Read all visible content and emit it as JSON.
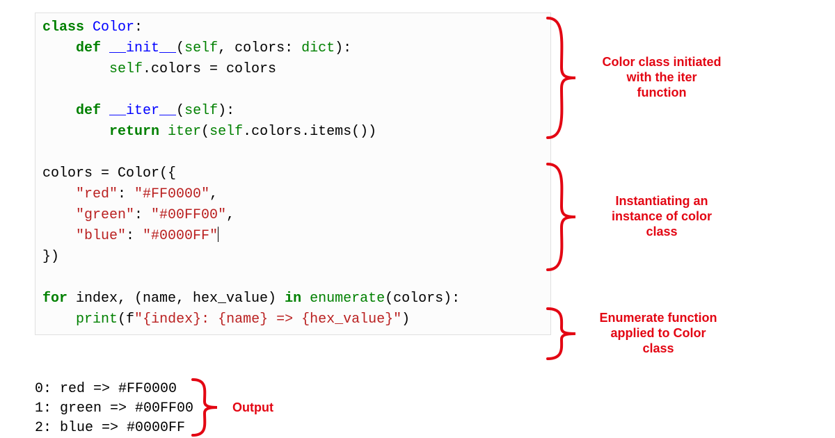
{
  "code": {
    "lines": [
      [
        {
          "t": "class ",
          "c": "kw"
        },
        {
          "t": "Color",
          "c": "cls"
        },
        {
          "t": ":",
          "c": ""
        }
      ],
      [
        {
          "t": "    ",
          "c": ""
        },
        {
          "t": "def ",
          "c": "kw"
        },
        {
          "t": "__init__",
          "c": "dunder"
        },
        {
          "t": "(",
          "c": ""
        },
        {
          "t": "self",
          "c": "builtin"
        },
        {
          "t": ", colors: ",
          "c": ""
        },
        {
          "t": "dict",
          "c": "builtin"
        },
        {
          "t": "):",
          "c": ""
        }
      ],
      [
        {
          "t": "        ",
          "c": ""
        },
        {
          "t": "self",
          "c": "builtin"
        },
        {
          "t": ".colors = colors",
          "c": ""
        }
      ],
      [
        {
          "t": "",
          "c": ""
        }
      ],
      [
        {
          "t": "    ",
          "c": ""
        },
        {
          "t": "def ",
          "c": "kw"
        },
        {
          "t": "__iter__",
          "c": "dunder"
        },
        {
          "t": "(",
          "c": ""
        },
        {
          "t": "self",
          "c": "builtin"
        },
        {
          "t": "):",
          "c": ""
        }
      ],
      [
        {
          "t": "        ",
          "c": ""
        },
        {
          "t": "return ",
          "c": "kw"
        },
        {
          "t": "iter",
          "c": "builtin"
        },
        {
          "t": "(",
          "c": ""
        },
        {
          "t": "self",
          "c": "builtin"
        },
        {
          "t": ".colors.items())",
          "c": ""
        }
      ],
      [
        {
          "t": "",
          "c": ""
        }
      ],
      [
        {
          "t": "colors = Color({",
          "c": ""
        }
      ],
      [
        {
          "t": "    ",
          "c": ""
        },
        {
          "t": "\"red\"",
          "c": "str"
        },
        {
          "t": ": ",
          "c": ""
        },
        {
          "t": "\"#FF0000\"",
          "c": "str"
        },
        {
          "t": ",",
          "c": ""
        }
      ],
      [
        {
          "t": "    ",
          "c": ""
        },
        {
          "t": "\"green\"",
          "c": "str"
        },
        {
          "t": ": ",
          "c": ""
        },
        {
          "t": "\"#00FF00\"",
          "c": "str"
        },
        {
          "t": ",",
          "c": ""
        }
      ],
      [
        {
          "t": "    ",
          "c": ""
        },
        {
          "t": "\"blue\"",
          "c": "str"
        },
        {
          "t": ": ",
          "c": ""
        },
        {
          "t": "\"#0000FF\"",
          "c": "str"
        },
        {
          "t": "",
          "c": "",
          "cursor": true
        }
      ],
      [
        {
          "t": "})",
          "c": ""
        }
      ],
      [
        {
          "t": "",
          "c": ""
        }
      ],
      [
        {
          "t": "for ",
          "c": "kw"
        },
        {
          "t": "index, (name, hex_value) ",
          "c": ""
        },
        {
          "t": "in ",
          "c": "kw"
        },
        {
          "t": "enumerate",
          "c": "builtin"
        },
        {
          "t": "(colors):",
          "c": ""
        }
      ],
      [
        {
          "t": "    ",
          "c": ""
        },
        {
          "t": "print",
          "c": "builtin"
        },
        {
          "t": "(f",
          "c": ""
        },
        {
          "t": "\"",
          "c": "str"
        },
        {
          "t": "{index}",
          "c": "str"
        },
        {
          "t": ": ",
          "c": "str"
        },
        {
          "t": "{name}",
          "c": "str"
        },
        {
          "t": " => ",
          "c": "str"
        },
        {
          "t": "{hex_value}",
          "c": "str"
        },
        {
          "t": "\"",
          "c": "str"
        },
        {
          "t": ")",
          "c": ""
        }
      ]
    ]
  },
  "output": {
    "lines": [
      "0: red => #FF0000",
      "1: green => #00FF00",
      "2: blue => #0000FF"
    ]
  },
  "annotations": {
    "a1_l1": "Color class initiated",
    "a1_l2": "with the iter",
    "a1_l3": "function",
    "a2_l1": "Instantiating an",
    "a2_l2": "instance of color",
    "a2_l3": "class",
    "a3_l1": "Enumerate function",
    "a3_l2": "applied to Color",
    "a3_l3": "class",
    "a4": "Output"
  },
  "colors": {
    "annot": "#e30613"
  }
}
